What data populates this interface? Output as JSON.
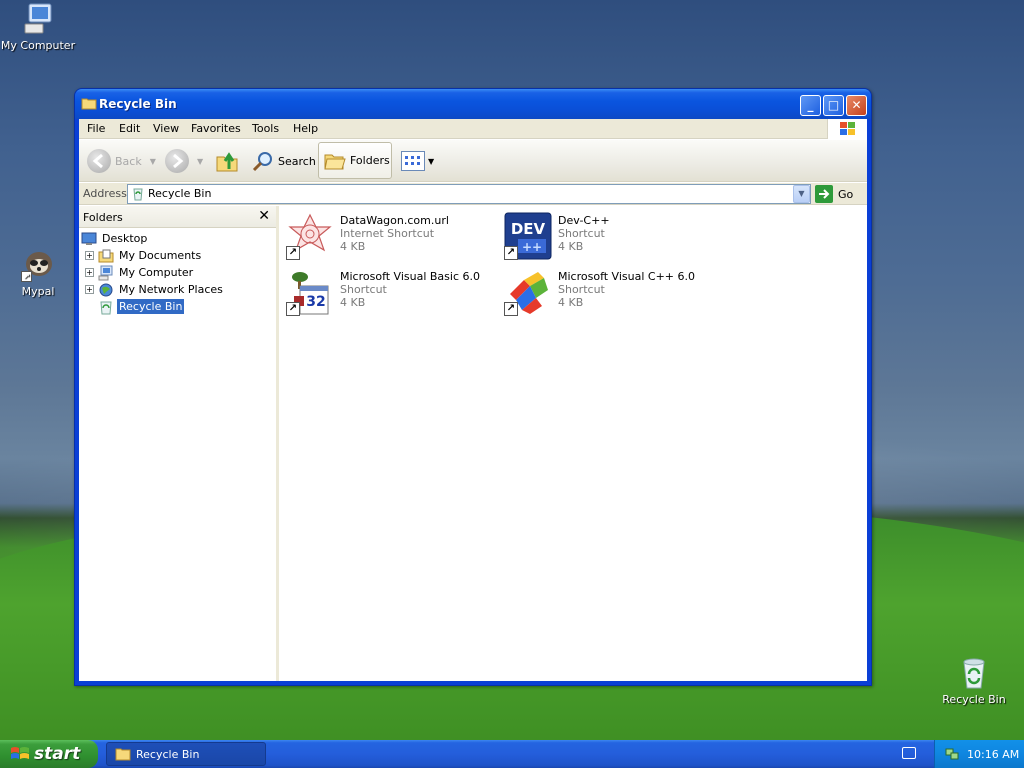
{
  "desktop": {
    "icons": [
      {
        "label": "My Computer"
      },
      {
        "label": "Mypal"
      },
      {
        "label": "Recycle Bin"
      }
    ]
  },
  "window": {
    "title": "Recycle Bin",
    "menu": [
      "File",
      "Edit",
      "View",
      "Favorites",
      "Tools",
      "Help"
    ],
    "toolbar": {
      "back_label": "Back",
      "search_label": "Search",
      "folders_label": "Folders"
    },
    "address": {
      "label": "Address",
      "value": "Recycle Bin",
      "go_label": "Go"
    },
    "folders_pane": {
      "title": "Folders",
      "tree": [
        {
          "label": "Desktop"
        },
        {
          "label": "My Documents"
        },
        {
          "label": "My Computer"
        },
        {
          "label": "My Network Places"
        },
        {
          "label": "Recycle Bin",
          "selected": true
        }
      ]
    },
    "files": [
      {
        "name": "DataWagon.com.url",
        "type": "Internet Shortcut",
        "size": "4 KB"
      },
      {
        "name": "Dev-C++",
        "type": "Shortcut",
        "size": "4 KB"
      },
      {
        "name": "Microsoft Visual Basic 6.0",
        "type": "Shortcut",
        "size": "4 KB"
      },
      {
        "name": "Microsoft Visual C++ 6.0",
        "type": "Shortcut",
        "size": "4 KB"
      }
    ]
  },
  "taskbar": {
    "start_label": "start",
    "task_label": "Recycle Bin",
    "clock": "10:16 AM"
  },
  "colors": {
    "title_bar": "#0a55df",
    "selection": "#316ac5",
    "start_green": "#3c9e3c",
    "tray_blue": "#0f86e0"
  }
}
